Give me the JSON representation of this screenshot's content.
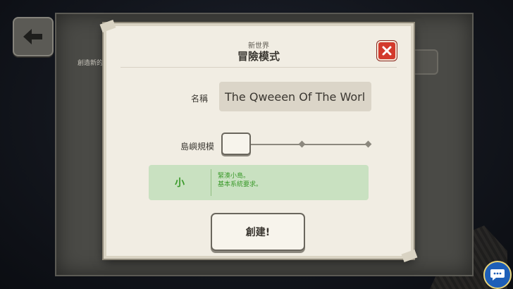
{
  "background_screen": {
    "subtitle": "創造新的"
  },
  "dialog": {
    "subtitle": "新世界",
    "title": "冒險模式",
    "name": {
      "label": "名稱",
      "value": "The Qweeen Of The World"
    },
    "island_size": {
      "label": "島嶼規模",
      "steps": 3,
      "selected_step": 1,
      "value": "小",
      "description_line1": "緊湊小島。",
      "description_line2": "基本系統要求。"
    },
    "create_button_label": "創建!"
  },
  "icons": {
    "back": "arrow-left-icon",
    "close": "close-x-icon",
    "chat": "chat-bubble-icon"
  },
  "colors": {
    "close_red": "#d33a2c",
    "accent_green": "#3b9a2b",
    "info_bg": "#c9e1c1",
    "dialog_bg": "#f1ede3"
  }
}
